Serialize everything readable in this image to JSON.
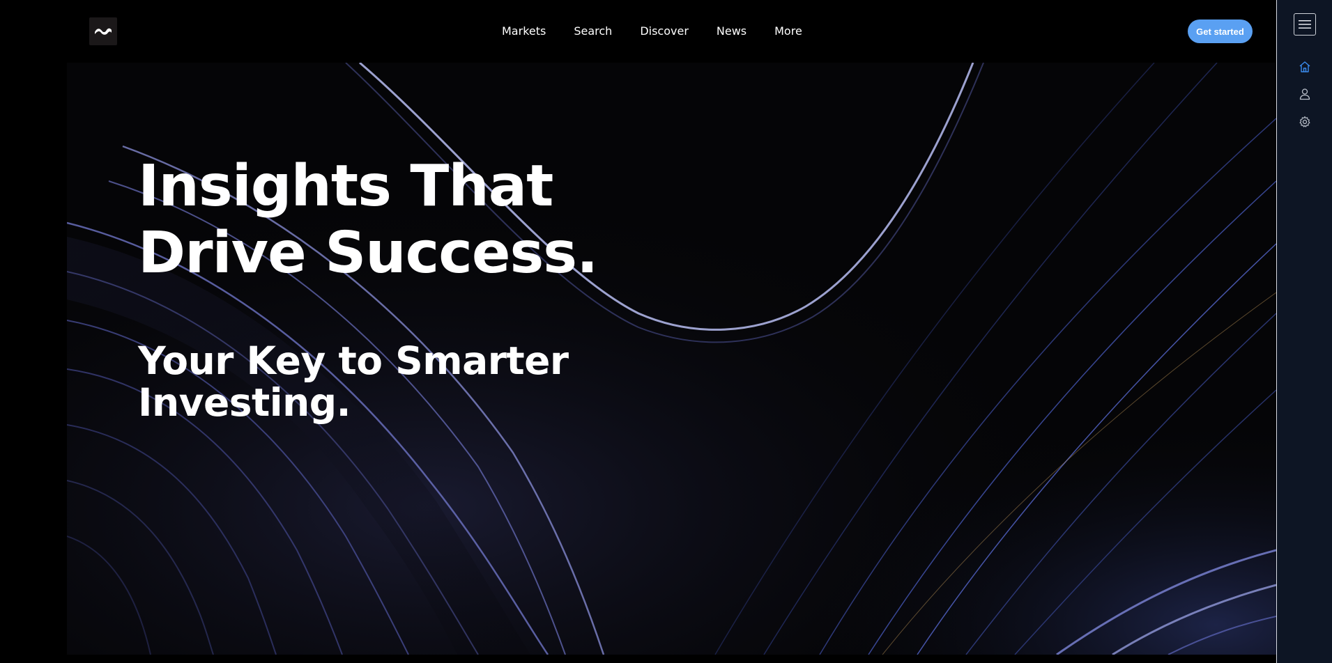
{
  "header": {
    "logo_icon": "wave-logo-icon",
    "nav_items": [
      {
        "label": "Markets"
      },
      {
        "label": "Search"
      },
      {
        "label": "Discover"
      },
      {
        "label": "News"
      },
      {
        "label": "More"
      }
    ],
    "cta_label": "Get started"
  },
  "hero": {
    "headline_line1": "Insights That",
    "headline_line2": "Drive Success.",
    "subheadline_line1": "Your Key to Smarter",
    "subheadline_line2": "Investing."
  },
  "sidebar": {
    "menu_icon": "hamburger-menu-icon",
    "items": [
      {
        "icon": "home-icon",
        "active": true
      },
      {
        "icon": "user-icon",
        "active": false
      },
      {
        "icon": "settings-gear-icon",
        "active": false
      }
    ]
  },
  "colors": {
    "accent": "#5aa0f2",
    "background": "#000000",
    "sidebar_bg": "#0d1524",
    "active_icon": "#3b8cf0"
  }
}
